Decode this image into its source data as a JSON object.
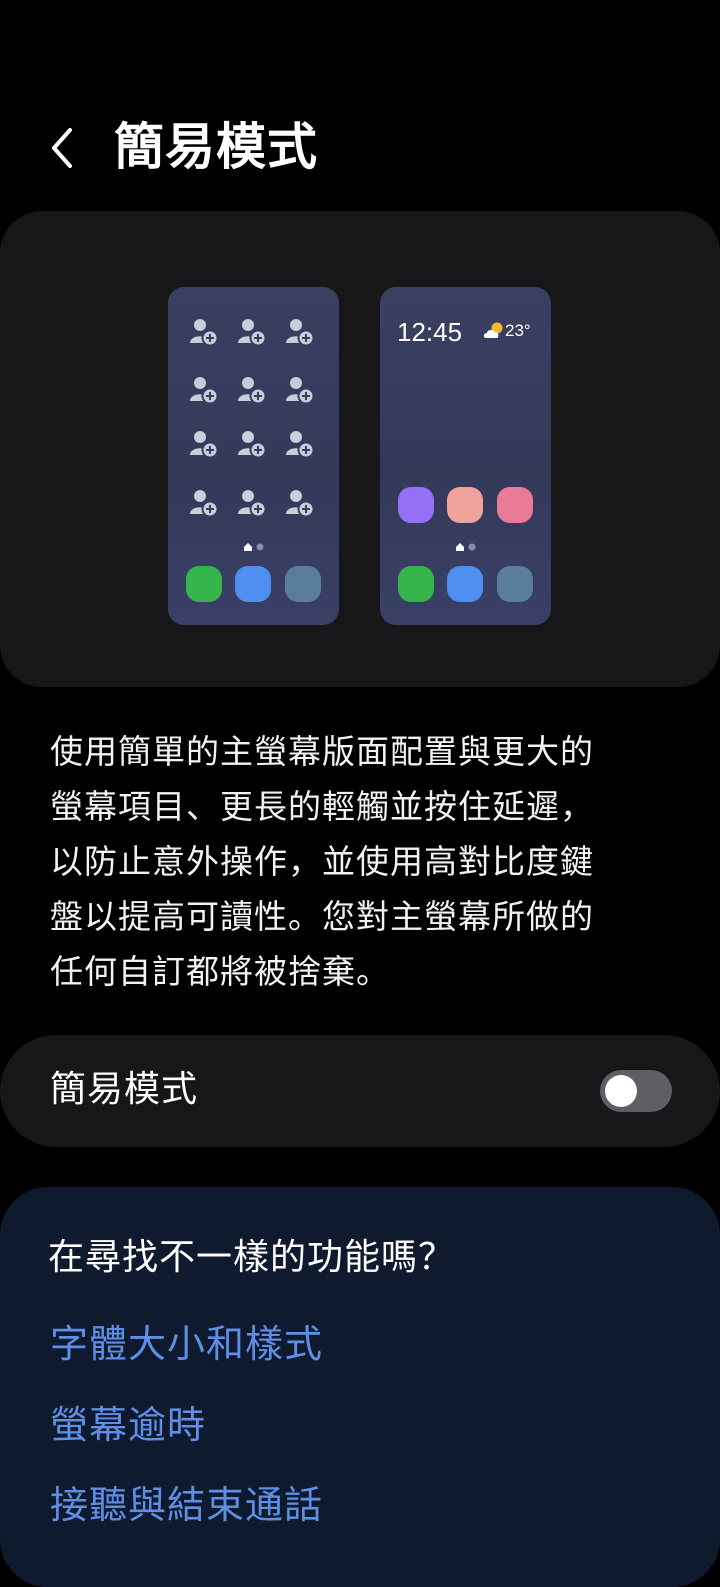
{
  "header": {
    "title": "簡易模式"
  },
  "preview": {
    "easy_phone": {
      "clock": "12:45",
      "temperature": "23°"
    }
  },
  "description": "使用簡單的主螢幕版面配置與更大的\n螢幕項目、更長的輕觸並按住延遲，\n以防止意外操作，並使用高對比度鍵\n盤以提高可讀性。您對主螢幕所做的\n任何自訂都將被捨棄。",
  "setting": {
    "label": "簡易模式",
    "enabled": false
  },
  "related": {
    "heading": "在尋找不一樣的功能嗎？",
    "links": [
      "字體大小和樣式",
      "螢幕逾時",
      "接聽與結束通話"
    ]
  },
  "colors": {
    "link": "#5e8ee6",
    "app_green": "#36b54d",
    "app_blue": "#4f8ff0",
    "app_teal": "#5a7d9c",
    "app_purple": "#9370f5",
    "app_salmon": "#f2a29c",
    "app_pink": "#e97a98"
  }
}
